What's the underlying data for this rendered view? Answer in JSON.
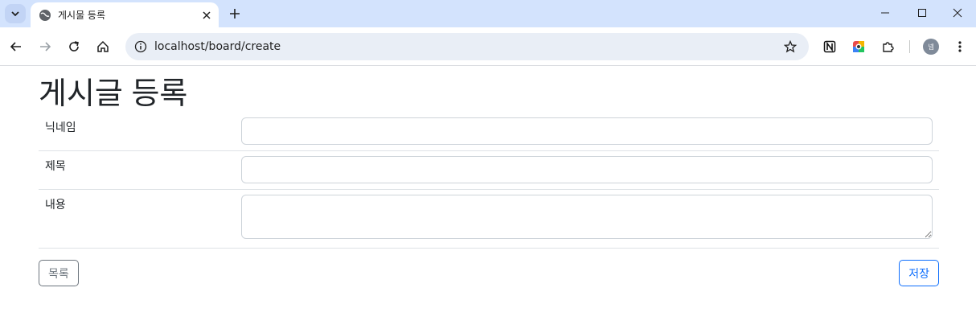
{
  "browser": {
    "tab_title": "게시물 등록",
    "url": "localhost/board/create",
    "avatar_text": "넴"
  },
  "page": {
    "heading": "게시글 등록",
    "fields": [
      {
        "label": "닉네임",
        "value": ""
      },
      {
        "label": "제목",
        "value": ""
      },
      {
        "label": "내용",
        "value": ""
      }
    ],
    "list_button": "목록",
    "save_button": "저장"
  },
  "colors": {
    "tabbar": "#d3e3fd",
    "primary": "#0d6efd",
    "secondary": "#6c757d"
  }
}
